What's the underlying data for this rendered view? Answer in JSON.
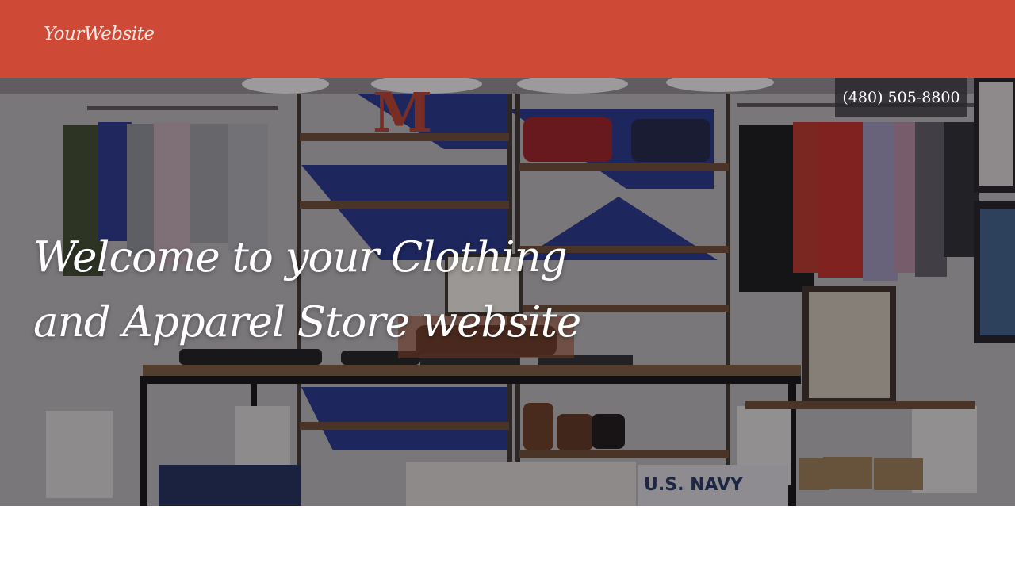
{
  "header": {
    "logo_text": "YourWebsite",
    "background_color": "#cf4a36"
  },
  "hero": {
    "phone": "(480) 505-8800",
    "headline": "Welcome to your Clothing and Apparel Store website",
    "image_description": "clothing-store-interior-photo",
    "sign_text": "U.S. NAVY",
    "shelf_letter": "M"
  }
}
